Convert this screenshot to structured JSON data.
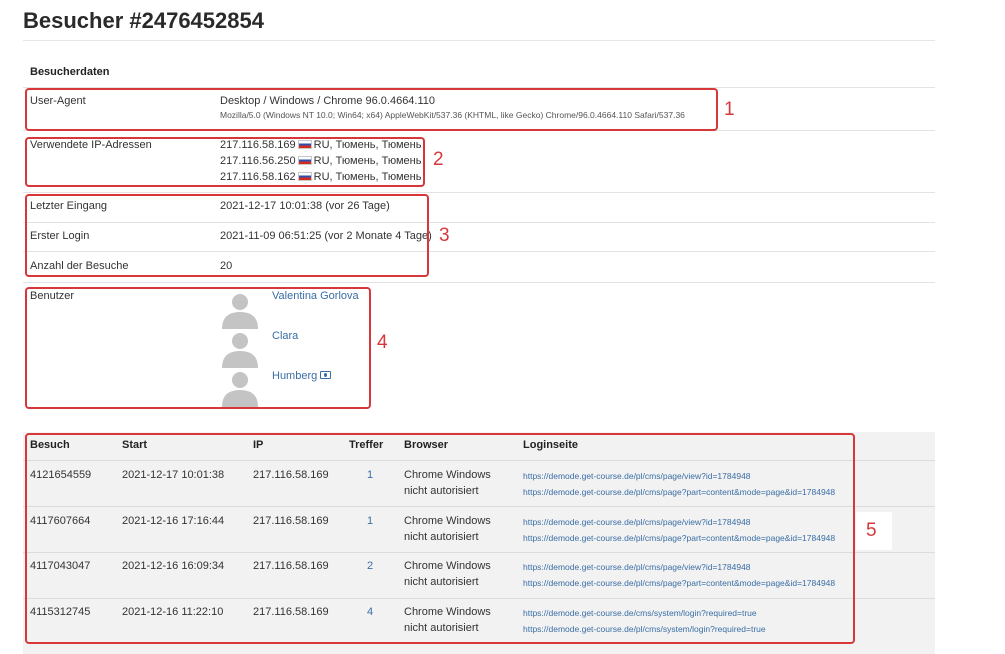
{
  "page": {
    "title": "Besucher #2476452854"
  },
  "details": {
    "section_title": "Besucherdaten",
    "user_agent": {
      "label": "User-Agent",
      "summary": "Desktop / Windows / Chrome 96.0.4664.110",
      "full": "Mozilla/5.0 (Windows NT 10.0; Win64; x64) AppleWebKit/537.36 (KHTML, like Gecko) Chrome/96.0.4664.110 Safari/537.36"
    },
    "ips": {
      "label": "Verwendete IP-Adressen",
      "items": [
        {
          "ip": "217.116.58.169",
          "location": "RU, Тюмень, Тюмень"
        },
        {
          "ip": "217.116.56.250",
          "location": "RU, Тюмень, Тюмень"
        },
        {
          "ip": "217.116.58.162",
          "location": "RU, Тюмень, Тюмень"
        }
      ]
    },
    "last_entry": {
      "label": "Letzter Eingang",
      "value": "2021-12-17 10:01:38 (vor 26 Tage)"
    },
    "first_login": {
      "label": "Erster Login",
      "value": "2021-11-09 06:51:25 (vor 2 Monate 4 Tage)"
    },
    "visit_count": {
      "label": "Anzahl der Besuche",
      "value": "20"
    },
    "users": {
      "label": "Benutzer",
      "items": [
        {
          "name": "Valentina Gorlova"
        },
        {
          "name": "Clara"
        },
        {
          "name": "Humberg"
        }
      ]
    }
  },
  "visits": {
    "headers": {
      "visit": "Besuch",
      "start": "Start",
      "ip": "IP",
      "hits": "Treffer",
      "browser": "Browser",
      "login_page": "Loginseite"
    },
    "rows": [
      {
        "id": "4121654559",
        "start": "2021-12-17 10:01:38",
        "ip": "217.116.58.169",
        "hits": "1",
        "browser": "Chrome Windows",
        "auth": "nicht autorisiert",
        "urls": [
          "https://demode.get-course.de/pl/cms/page/view?id=1784948",
          "https://demode.get-course.de/pl/cms/page?part=content&mode=page&id=1784948"
        ]
      },
      {
        "id": "4117607664",
        "start": "2021-12-16 17:16:44",
        "ip": "217.116.58.169",
        "hits": "1",
        "browser": "Chrome Windows",
        "auth": "nicht autorisiert",
        "urls": [
          "https://demode.get-course.de/pl/cms/page/view?id=1784948",
          "https://demode.get-course.de/pl/cms/page?part=content&mode=page&id=1784948"
        ]
      },
      {
        "id": "4117043047",
        "start": "2021-12-16 16:09:34",
        "ip": "217.116.58.169",
        "hits": "2",
        "browser": "Chrome Windows",
        "auth": "nicht autorisiert",
        "urls": [
          "https://demode.get-course.de/pl/cms/page/view?id=1784948",
          "https://demode.get-course.de/pl/cms/page?part=content&mode=page&id=1784948"
        ]
      },
      {
        "id": "4115312745",
        "start": "2021-12-16 11:22:10",
        "ip": "217.116.58.169",
        "hits": "4",
        "browser": "Chrome Windows",
        "auth": "nicht autorisiert",
        "urls": [
          "https://demode.get-course.de/cms/system/login?required=true",
          "https://demode.get-course.de/pl/cms/system/login?required=true"
        ]
      }
    ]
  },
  "annotations": {
    "n1": "1",
    "n2": "2",
    "n3": "3",
    "n4": "4",
    "n5": "5"
  },
  "colors": {
    "highlight": "#d8373a",
    "link": "#3a6ea5",
    "table_bg": "#f2f2f2"
  },
  "icons": {
    "flag": "russia-flag-icon",
    "avatar": "user-avatar-icon",
    "id_card": "id-card-icon"
  }
}
